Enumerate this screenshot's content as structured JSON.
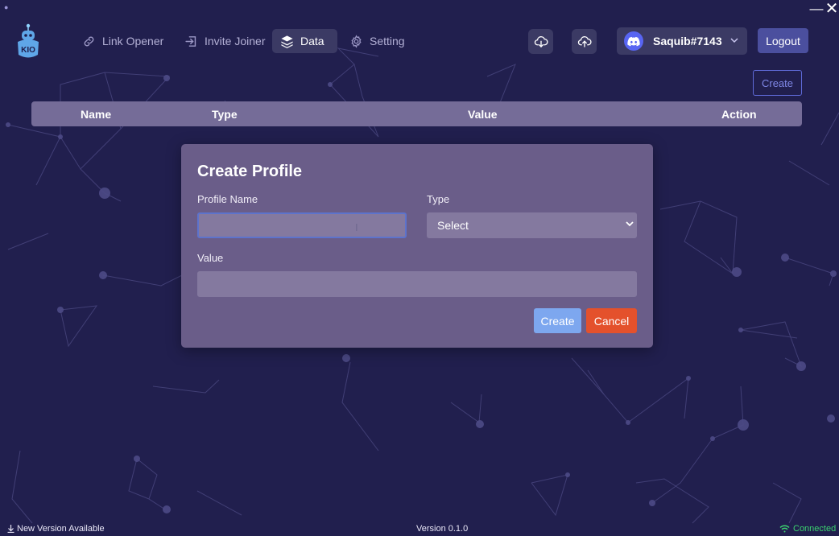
{
  "window": {
    "minimize_glyph": "—",
    "close_glyph": "✕"
  },
  "brand": {
    "logo_text": "KIO"
  },
  "nav": {
    "items": [
      {
        "label": "Link Opener",
        "icon": "link-icon",
        "active": false
      },
      {
        "label": "Invite Joiner",
        "icon": "enter-icon",
        "active": false
      },
      {
        "label": "Data",
        "icon": "layers-icon",
        "active": true
      },
      {
        "label": "Setting",
        "icon": "gear-icon",
        "active": false
      }
    ]
  },
  "header": {
    "cloud_download_icon": "cloud-download-icon",
    "cloud_upload_icon": "cloud-upload-icon",
    "user": {
      "name": "Saquib#7143",
      "avatar_icon": "discord-icon"
    },
    "logout_label": "Logout"
  },
  "toolbar": {
    "create_label": "Create"
  },
  "table": {
    "columns": [
      "Name",
      "Type",
      "Value",
      "Action"
    ]
  },
  "modal": {
    "title": "Create Profile",
    "profile_name_label": "Profile Name",
    "profile_name_value": "",
    "type_label": "Type",
    "type_selected": "Select",
    "value_label": "Value",
    "value_value": "",
    "create_label": "Create",
    "cancel_label": "Cancel"
  },
  "footer": {
    "update_text": "New Version Available",
    "version_text": "Version 0.1.0",
    "status_text": "Connected"
  },
  "colors": {
    "background": "#211f4e",
    "nav_active": "#3b3a64",
    "table_header": "#756c98",
    "modal_bg": "#6a5d89",
    "primary_button": "#7da7ef",
    "danger_button": "#e4512c",
    "status_ok": "#3bd16f",
    "discord": "#5865f2"
  }
}
